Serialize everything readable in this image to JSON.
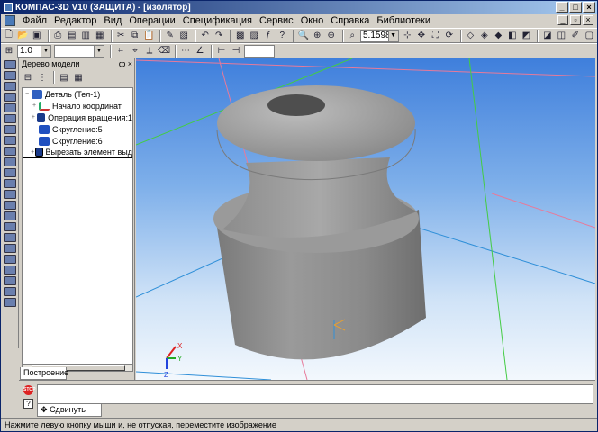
{
  "window": {
    "title": "КОМПАС-3D V10 (ЗАЩИТА) - [изолятор]"
  },
  "menu": [
    {
      "label": "Файл"
    },
    {
      "label": "Редактор"
    },
    {
      "label": "Вид"
    },
    {
      "label": "Операции"
    },
    {
      "label": "Спецификация"
    },
    {
      "label": "Сервис"
    },
    {
      "label": "Окно"
    },
    {
      "label": "Справка"
    },
    {
      "label": "Библиотеки"
    }
  ],
  "toolbar": {
    "zoom_value": "5.1598",
    "line_scale": "1.0"
  },
  "tree": {
    "title": "Дерево модели",
    "pin": "ф",
    "close": "×",
    "items": [
      {
        "label": "Деталь (Тел-1)",
        "icon": "part-icon"
      },
      {
        "label": "Начало координат",
        "icon": "origin-icon"
      },
      {
        "label": "Операция вращения:1",
        "icon": "rotation-icon"
      },
      {
        "label": "Скругление:5",
        "icon": "fillet-icon"
      },
      {
        "label": "Скругление:6",
        "icon": "fillet-icon"
      },
      {
        "label": "Вырезать элемент выд",
        "icon": "cut-icon"
      }
    ],
    "tab": "Построение"
  },
  "bottom": {
    "tab": "Сдвинуть"
  },
  "status": {
    "text": "Нажмите левую кнопку мыши и, не отпуская, переместите изображение"
  },
  "axes": {
    "x": "X",
    "y": "Y",
    "z": "Z"
  },
  "colors": {
    "titlebar": "#0a246a",
    "model": "#8f8f8f",
    "viewport_top": "#3f7fdc"
  }
}
